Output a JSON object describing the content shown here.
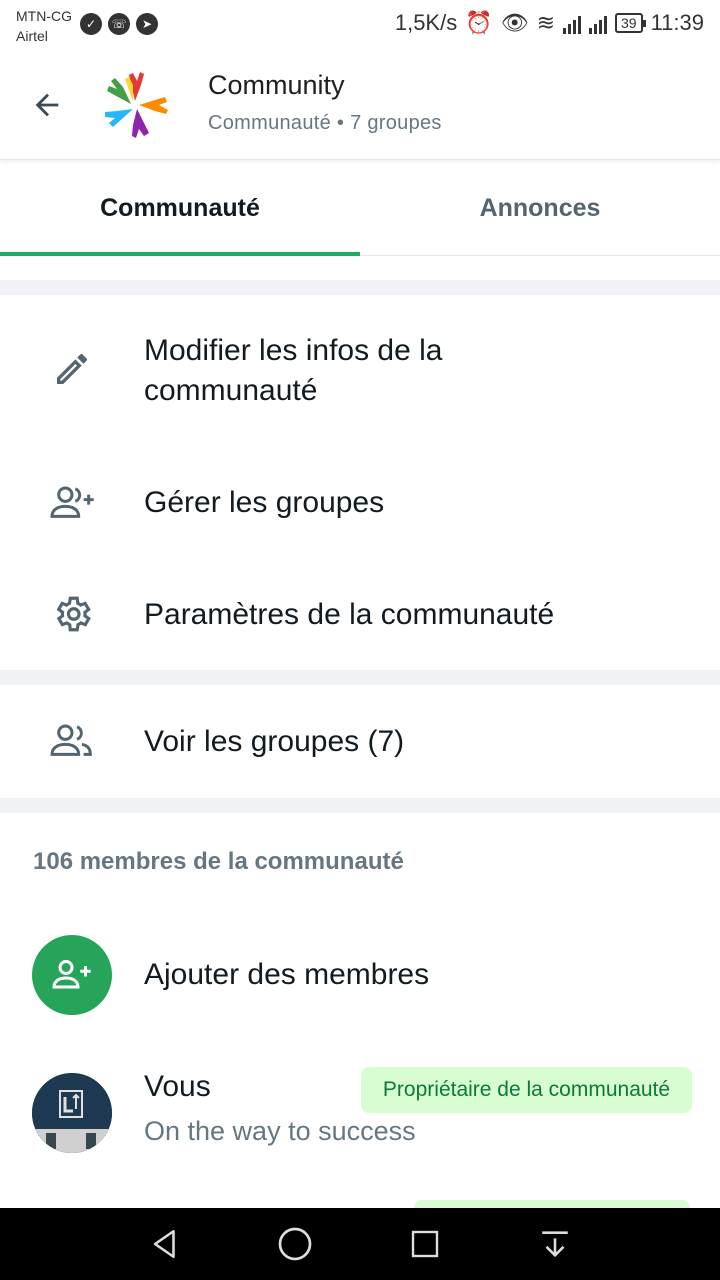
{
  "status_bar": {
    "carrier_1": "MTN-CG",
    "carrier_2": "Airtel",
    "speed": "1,5K/s",
    "battery": "39",
    "time": "11:39"
  },
  "header": {
    "title": "Community",
    "subtitle": "Communauté • 7 groupes"
  },
  "tabs": [
    {
      "label": "Communauté",
      "active": true
    },
    {
      "label": "Annonces",
      "active": false
    }
  ],
  "actions": {
    "edit_info": "Modifier les infos de la communauté",
    "manage_groups": "Gérer les groupes",
    "settings": "Paramètres de la communauté",
    "view_groups": "Voir les groupes (7)"
  },
  "members": {
    "count_label": "106 membres de la communauté",
    "add_label": "Ajouter des membres",
    "you_name": "Vous",
    "you_status": "On the way to success",
    "owner_badge": "Propriétaire de la communauté"
  },
  "colors": {
    "accent": "#1daa61",
    "badge_bg": "#d9fdd3"
  }
}
